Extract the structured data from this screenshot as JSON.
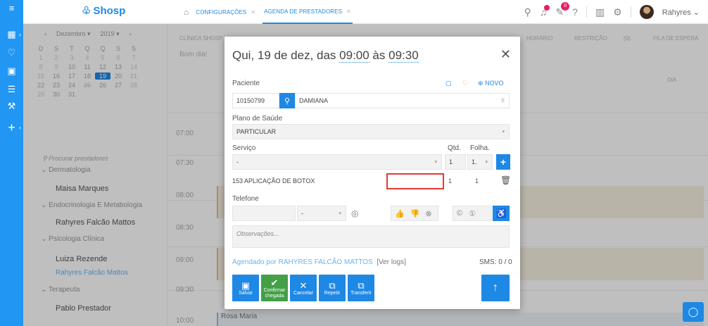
{
  "app": {
    "logo": "Shosp",
    "user_name": "Rahyres"
  },
  "tabs": [
    {
      "label": "CONFIGURAÇÕES"
    },
    {
      "label": "AGENDA DE PRESTADORES"
    }
  ],
  "notifications": {
    "count": "0"
  },
  "calendar": {
    "month": "Dezembro",
    "year": "2019",
    "weekdays": [
      "D",
      "S",
      "T",
      "Q",
      "Q",
      "S",
      "S"
    ],
    "days": [
      "1",
      "2",
      "3",
      "4",
      "5",
      "6",
      "7",
      "8",
      "9",
      "10",
      "11",
      "12",
      "13",
      "14",
      "15",
      "16",
      "17",
      "18",
      "19",
      "20",
      "21",
      "22",
      "23",
      "24",
      "25",
      "26",
      "27",
      "28",
      "29",
      "30",
      "31"
    ],
    "today": "19"
  },
  "providers": {
    "search_placeholder": "Procurar prestadores",
    "groups": [
      {
        "specialty": "Dermatologia",
        "names": [
          "Maisa Marques"
        ]
      },
      {
        "specialty": "Endocrinologia E Metabologia",
        "names": [
          "Rahyres Falcão Mattos"
        ]
      },
      {
        "specialty": "Psicologia Clínica",
        "names": [
          "Luiza Rezende",
          "Rahyres Falcão Mattos"
        ]
      },
      {
        "specialty": "Terapeuta",
        "names": [
          "Pablo Prestador"
        ]
      }
    ]
  },
  "agenda": {
    "clinic": "CLÍNICA SHOSP",
    "greeting": "Bom dia!",
    "toolbar": [
      "HORÁRIO",
      "RESTRIÇÃO",
      "(0)",
      "FILA DE ESPERA"
    ],
    "view": "DIA",
    "times": [
      "07:00",
      "07:30",
      "08:00",
      "08:30",
      "09:00",
      "09:30",
      "10:00"
    ],
    "last_appt": "Rosa Maria"
  },
  "modal": {
    "title_prefix": "Qui, 19 de dez, das ",
    "start": "09:00",
    "mid": " às ",
    "end": "09:30",
    "patient_label": "Paciente",
    "new_label": "NOVO",
    "patient_id": "10150799",
    "patient_name": "DAMIANA",
    "plan_label": "Plano de Saúde",
    "plan_value": "PARTICULAR",
    "service_label": "Serviço",
    "qty_label": "Qtd.",
    "sheet_label": "Folha.",
    "service_value": "-",
    "qty_value": "1",
    "sheet_value": "1.",
    "service_item": "153 APLICAÇÃO DE BOTOX",
    "item_qty": "1",
    "item_sheet": "1",
    "phone_label": "Telefone",
    "phone_ddi": "-",
    "notes_placeholder": "Observações...",
    "scheduled_by": "Agendado por RAHYRES FALCÃO MATTOS",
    "logs_link": "[Ver logs]",
    "sms": "SMS: 0 / 0",
    "buttons": {
      "save": "Salvar",
      "confirm": "Confirmar chegada",
      "cancel": "Cancelar",
      "repeat": "Repetir",
      "transfer": "Transferir"
    }
  }
}
